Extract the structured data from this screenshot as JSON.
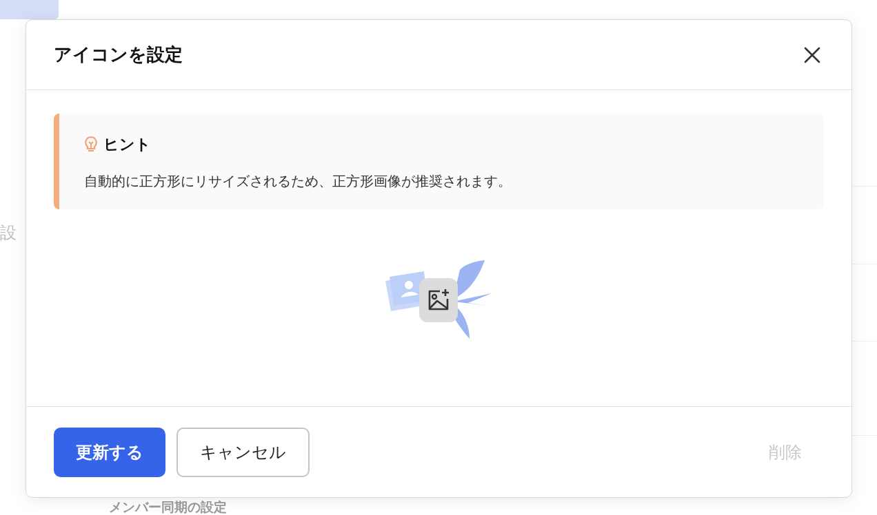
{
  "background": {
    "side_label": "設",
    "section_title": "メンバー同期の設定"
  },
  "dialog": {
    "title": "アイコンを設定",
    "hint": {
      "title": "ヒント",
      "text": "自動的に正方形にリサイズされるため、正方形画像が推奨されます。"
    },
    "buttons": [
      {
        "label": "更新する",
        "kind": "primary",
        "disabled": false
      },
      {
        "label": "キャンセル",
        "kind": "secondary",
        "disabled": false
      },
      {
        "label": "削除",
        "kind": "delete",
        "disabled": true
      }
    ]
  }
}
